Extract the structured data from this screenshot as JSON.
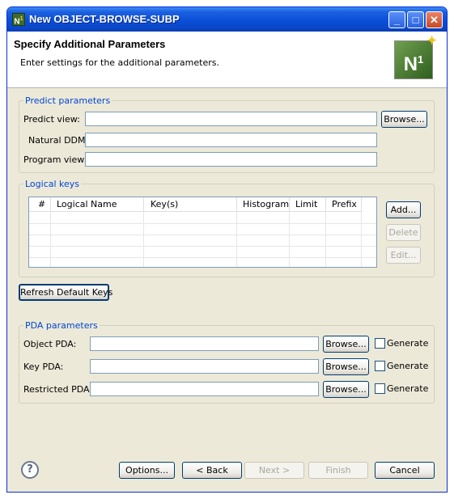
{
  "window": {
    "title": "New OBJECT-BROWSE-SUBP",
    "app_icon": "N1",
    "controls": {
      "minimize": "_",
      "maximize": "□",
      "close": "✕"
    }
  },
  "header": {
    "title": "Specify Additional Parameters",
    "description": "Enter settings for the additional parameters.",
    "logo": "N1"
  },
  "predict": {
    "legend": "Predict parameters",
    "predict_view_label": "Predict view:",
    "predict_view_value": "",
    "natural_ddm_label": "Natural DDM:",
    "natural_ddm_value": "",
    "program_view_label": "Program view:",
    "program_view_value": "",
    "browse_label": "Browse..."
  },
  "logical_keys": {
    "legend": "Logical keys",
    "columns": [
      "#",
      "Logical Name",
      "Key(s)",
      "Histogram",
      "Limit",
      "Prefix"
    ],
    "rows": [],
    "add_label": "Add...",
    "delete_label": "Delete",
    "edit_label": "Edit..."
  },
  "refresh_label": "Refresh Default Keys",
  "pda": {
    "legend": "PDA parameters",
    "object_label": "Object PDA:",
    "object_value": "",
    "key_label": "Key PDA:",
    "key_value": "",
    "restricted_label": "Restricted PDA:",
    "restricted_value": "",
    "browse_label": "Browse...",
    "generate_label": "Generate"
  },
  "footer": {
    "help_icon": "?",
    "options_label": "Options...",
    "back_label": "< Back",
    "next_label": "Next >",
    "finish_label": "Finish",
    "cancel_label": "Cancel"
  }
}
